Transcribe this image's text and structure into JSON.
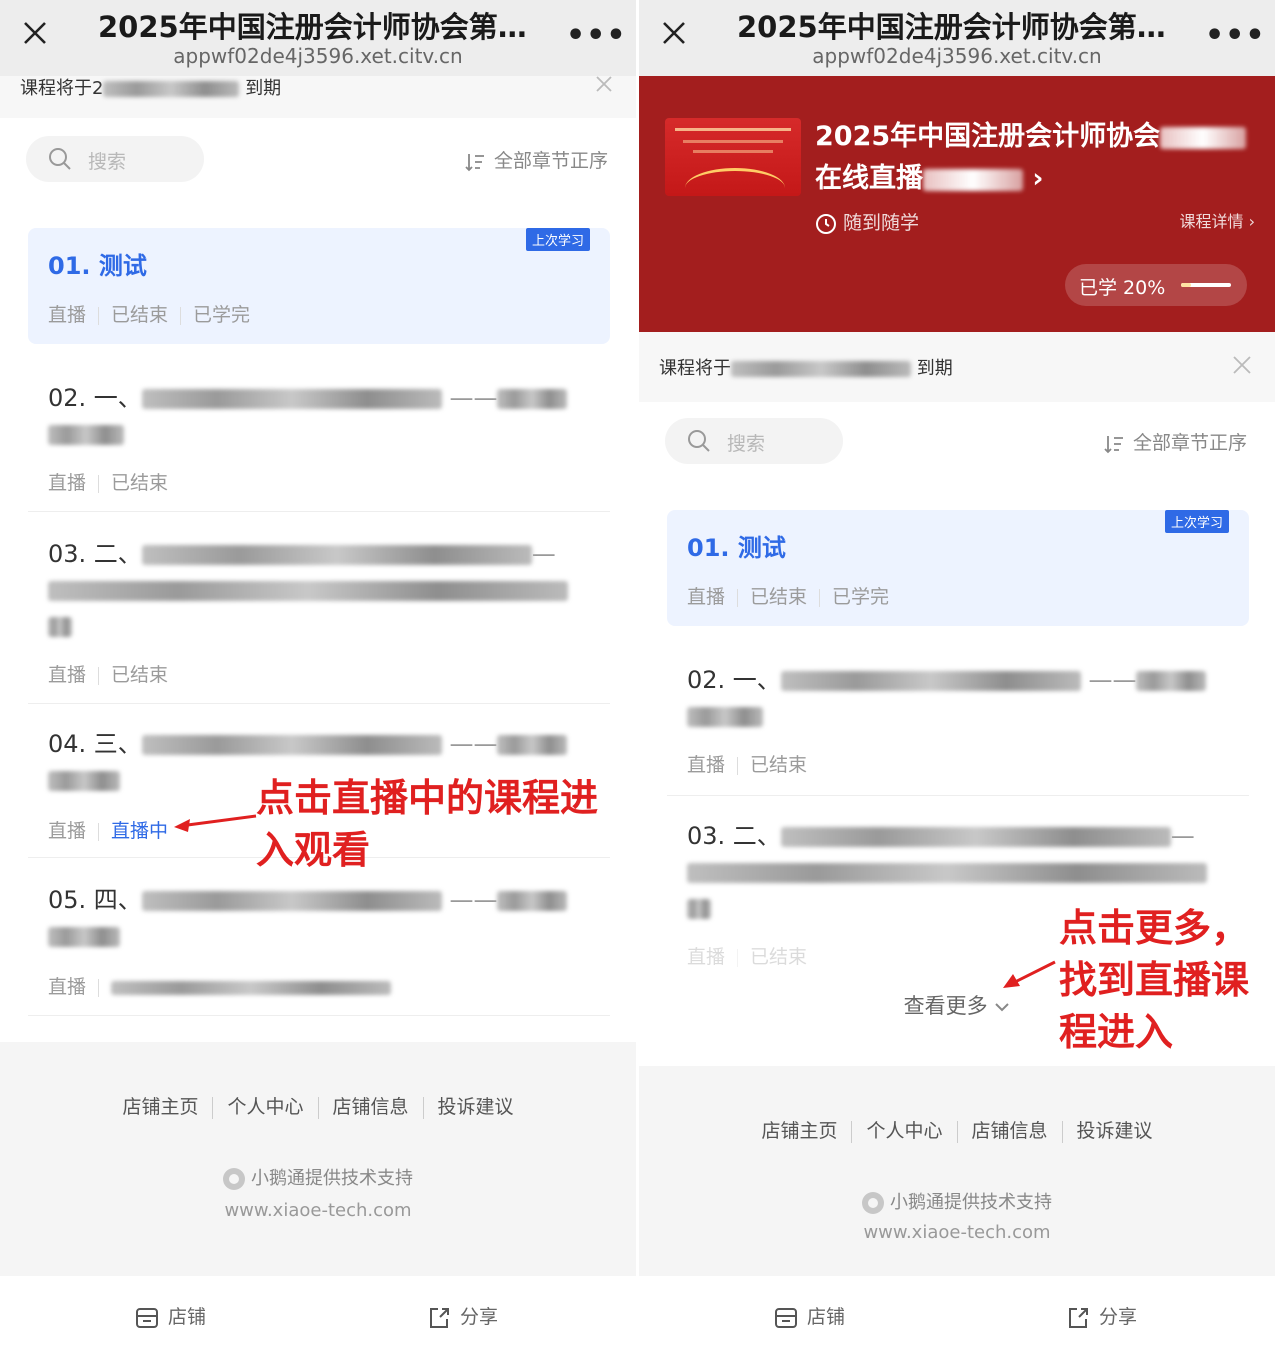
{
  "wechat_nav": {
    "title": "2025年中国注册会计师协会第…",
    "url": "appwf02de4j3596.xet.citv.cn",
    "more": "•••"
  },
  "expiry": {
    "prefix": "课程将于",
    "left_visible": "2",
    "suffix": "到期"
  },
  "search": {
    "placeholder": "搜索"
  },
  "sort_label": "全部章节正序",
  "lessons": [
    {
      "title": "01. 测试",
      "badge": "上次学习",
      "meta": [
        "直播",
        "已结束",
        "已学完"
      ]
    },
    {
      "title_prefix": "02. 一、",
      "meta": [
        "直播",
        "已结束"
      ]
    },
    {
      "title_prefix": "03. 二、",
      "meta": [
        "直播",
        "已结束"
      ]
    },
    {
      "title_prefix": "04. 三、",
      "meta": [
        "直播",
        "直播中"
      ]
    },
    {
      "title_prefix": "05. 四、",
      "meta": [
        "直播"
      ]
    }
  ],
  "footer": {
    "links": [
      "店铺主页",
      "个人中心",
      "店铺信息",
      "投诉建议"
    ],
    "tech": "小鹅通提供技术支持",
    "tech_url": "www.xiaoe-tech.com"
  },
  "tabbar": {
    "store": "店铺",
    "share": "分享"
  },
  "annotations": {
    "left_line1": "点击直播中的课程进",
    "left_line2": "入观看",
    "right_line1": "点击更多，",
    "right_line2": "找到直播课",
    "right_line3": "程进入"
  },
  "course": {
    "title_line1": "2025年中国注册会计师协会",
    "title_line2": "在线直播",
    "anytime": "随到随学",
    "detail": "课程详情",
    "progress_label": "已学 20%",
    "progress": 0.2
  },
  "see_more": "查看更多",
  "colors": {
    "accent_blue": "#2f6ae6",
    "annotation_red": "#e02020",
    "course_banner": "#a31e1e"
  }
}
